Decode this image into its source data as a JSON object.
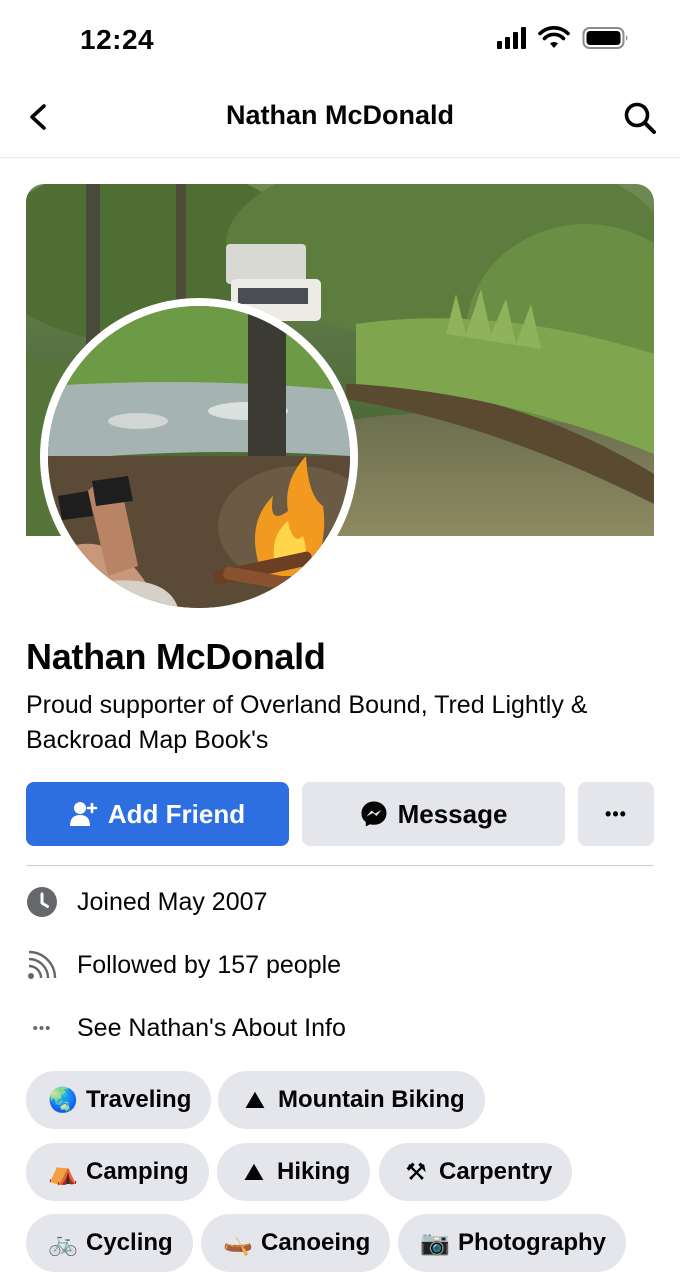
{
  "status_bar": {
    "time": "12:24"
  },
  "nav": {
    "title": "Nathan McDonald"
  },
  "profile": {
    "name": "Nathan McDonald",
    "bio": "Proud supporter of Overland Bound, Tred Lightly & Backroad Map Book's"
  },
  "actions": {
    "add_friend": "Add Friend",
    "message": "Message",
    "more": "•••"
  },
  "info": {
    "joined": "Joined May 2007",
    "followers": "Followed by 157 people",
    "about": "See Nathan's About Info",
    "about_icon": "•••"
  },
  "hobbies": [
    {
      "emoji": "🌏",
      "label": "Traveling",
      "icon": "globe-icon"
    },
    {
      "emoji": "⛰",
      "label": "Mountain Biking",
      "icon": "mountain-icon"
    },
    {
      "emoji": "⛺",
      "label": "Camping",
      "icon": "tent-icon"
    },
    {
      "emoji": "⛰",
      "label": "Hiking",
      "icon": "mountain-icon"
    },
    {
      "emoji": "⚒",
      "label": "Carpentry",
      "icon": "tools-icon"
    },
    {
      "emoji": "🚲",
      "label": "Cycling",
      "icon": "bicycle-icon"
    },
    {
      "emoji": "🛶",
      "label": "Canoeing",
      "icon": "canoe-icon"
    },
    {
      "emoji": "📷",
      "label": "Photography",
      "icon": "camera-icon"
    }
  ],
  "colors": {
    "primary": "#2d6fe0",
    "secondary_button": "#e4e6eb",
    "text": "#050505"
  }
}
